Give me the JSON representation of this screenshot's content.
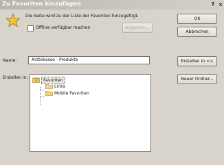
{
  "window": {
    "title": "Zu Favoriten hinzufügen",
    "help_button": "?",
    "close_button": "×"
  },
  "message": "Die Seite wird zu der Liste der Favoriten hinzugefügt.",
  "offline": {
    "label": "Offline verfügbar machen",
    "checked": false,
    "customize_label": "Anpassen..."
  },
  "buttons": {
    "ok": "OK",
    "cancel": "Abbrechen",
    "create_in": "Erstellen in <<",
    "new_folder": "Neuer Ordner..."
  },
  "name": {
    "label": "Name:",
    "value": "Arztekasse - Produkte"
  },
  "create_in": {
    "label": "Erstellen in:",
    "tree": [
      {
        "label": "Favoriten",
        "level": 0,
        "selected": true,
        "icon": "star-folder-icon"
      },
      {
        "label": "Links",
        "level": 1,
        "selected": false,
        "icon": "folder-icon"
      },
      {
        "label": "Mobile Favoriten",
        "level": 1,
        "selected": false,
        "icon": "folder-icon"
      }
    ]
  },
  "colors": {
    "dialog_bg": "#d8d4cb",
    "titlebar": "#b7b5ad",
    "star_fill": "#f5c53a",
    "folder_fill": "#f3d57a"
  }
}
